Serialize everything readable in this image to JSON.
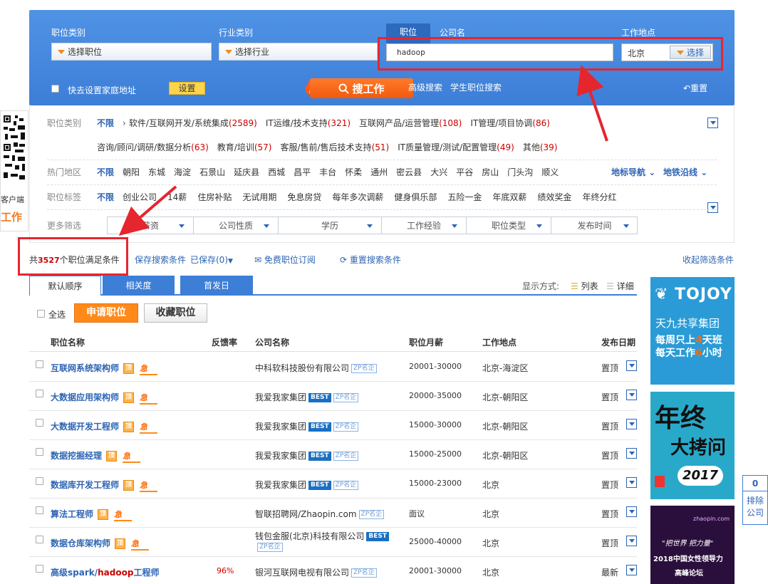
{
  "search": {
    "job_category_label": "职位类别",
    "job_category_value": "选择职位",
    "industry_label": "行业类别",
    "industry_value": "选择行业",
    "tab_position": "职位",
    "tab_company": "公司名",
    "keyword": "hadoop",
    "location_label": "工作地点",
    "location_value": "北京",
    "location_button": "选择",
    "home_address_label": "快去设置家庭地址",
    "set_button": "设置",
    "search_button": "搜工作",
    "advanced_search": "高级搜索",
    "student_search": "学生职位搜索",
    "reset": "重置"
  },
  "filters": {
    "category_title": "职位类别",
    "unlimited": "不限",
    "categories_row1": [
      {
        "name": "软件/互联网开发/系统集成",
        "count": "(2589)"
      },
      {
        "name": "IT运维/技术支持",
        "count": "(321)"
      },
      {
        "name": "互联网产品/运营管理",
        "count": "(108)"
      },
      {
        "name": "IT管理/项目协调",
        "count": "(86)"
      }
    ],
    "categories_row2": [
      {
        "name": "咨询/顾问/调研/数据分析",
        "count": "(63)"
      },
      {
        "name": "教育/培训",
        "count": "(57)"
      },
      {
        "name": "客服/售前/售后技术支持",
        "count": "(51)"
      },
      {
        "name": "IT质量管理/测试/配置管理",
        "count": "(49)"
      },
      {
        "name": "其他",
        "count": "(39)"
      }
    ],
    "area_title": "热门地区",
    "areas": [
      "朝阳",
      "东城",
      "海淀",
      "石景山",
      "延庆县",
      "西城",
      "昌平",
      "丰台",
      "怀柔",
      "通州",
      "密云县",
      "大兴",
      "平谷",
      "房山",
      "门头沟",
      "顺义"
    ],
    "landmark_nav": "地标导航",
    "subway_nav": "地铁沿线",
    "tag_title": "职位标签",
    "tags": [
      "创业公司",
      "14薪",
      "住房补贴",
      "无试用期",
      "免息房贷",
      "每年多次调薪",
      "健身俱乐部",
      "五险一金",
      "年底双薪",
      "绩效奖金",
      "年终分红"
    ],
    "more_title": "更多筛选",
    "more": [
      "薪资",
      "公司性质",
      "学历",
      "工作经验",
      "职位类型",
      "发布时间"
    ]
  },
  "results": {
    "prefix": "共",
    "count": "3527",
    "suffix": "个职位满足条件",
    "save_search": "保存搜索条件",
    "saved": "已保存(0)",
    "subscribe": "免费职位订阅",
    "reset_conditions": "重置搜索条件",
    "collapse": "收起筛选条件"
  },
  "sort": {
    "tabs": [
      "默认顺序",
      "相关度",
      "首发日"
    ],
    "display_label": "显示方式:",
    "list": "列表",
    "detail": "详细"
  },
  "actions": {
    "select_all": "全选",
    "apply": "申请职位",
    "favorite": "收藏职位"
  },
  "table": {
    "headers": [
      "职位名称",
      "反馈率",
      "公司名称",
      "职位月薪",
      "工作地点",
      "发布日期"
    ],
    "rows": [
      {
        "title": "互联网系统架构师",
        "ding": "顶",
        "ji": "急",
        "feedback": "",
        "company": "中科软科技股份有限公司",
        "best": false,
        "zp": "ZP名企",
        "salary": "20001-30000",
        "location": "北京-海淀区",
        "date": "置顶"
      },
      {
        "title": "大数据应用架构师",
        "ding": "顶",
        "ji": "急",
        "feedback": "",
        "company": "我爱我家集团",
        "best": true,
        "zp": "ZP名企",
        "salary": "20000-35000",
        "location": "北京-朝阳区",
        "date": "置顶"
      },
      {
        "title": "大数据开发工程师",
        "ding": "顶",
        "ji": "急",
        "feedback": "",
        "company": "我爱我家集团",
        "best": true,
        "zp": "ZP名企",
        "salary": "15000-30000",
        "location": "北京-朝阳区",
        "date": "置顶"
      },
      {
        "title": "数据挖掘经理",
        "ding": "顶",
        "ji": "急",
        "feedback": "",
        "company": "我爱我家集团",
        "best": true,
        "zp": "ZP名企",
        "salary": "15000-25000",
        "location": "北京-朝阳区",
        "date": "置顶"
      },
      {
        "title": "数据库开发工程师",
        "ding": "顶",
        "ji": "急",
        "feedback": "",
        "company": "我爱我家集团",
        "best": true,
        "zp": "ZP名企",
        "salary": "15000-23000",
        "location": "北京",
        "date": "置顶"
      },
      {
        "title": "算法工程师",
        "ding": "顶",
        "ji": "急",
        "feedback": "",
        "company": "智联招聘网/Zhaopin.com",
        "best": false,
        "zp": "ZP名企",
        "salary": "面议",
        "location": "北京",
        "date": "置顶"
      },
      {
        "title": "数据仓库架构师",
        "ding": "顶",
        "ji": "急",
        "feedback": "",
        "company": "钱包金服(北京)科技有限公司",
        "best": true,
        "zp": "ZP名企",
        "salary": "25000-40000",
        "location": "北京",
        "date": "置顶"
      },
      {
        "title_pre": "高级spark/",
        "title_hl": "hadoop",
        "title_post": "工程师",
        "feedback": "96%",
        "company": "银河互联网电视有限公司",
        "best": false,
        "zp": "ZP名企",
        "salary": "20001-30000",
        "location": "北京",
        "date": "最新"
      }
    ]
  },
  "ads": {
    "tojoy_brand": "TOJOY",
    "tojoy_line1": "天九共享集团",
    "tojoy_line2a": "每周只上",
    "tojoy_line2b": "4",
    "tojoy_line2c": "天班",
    "tojoy_line3a": "每天工作",
    "tojoy_line3b": "6",
    "tojoy_line3c": "小时",
    "yearend_line1": "年终",
    "yearend_line2": "大拷问",
    "yearend_year": "2017",
    "women_line1": "\"把世界 把力量\"",
    "women_line2": "2018中国女性领导力",
    "women_line3": "高峰论坛",
    "women_logo": "zhaopin.com"
  },
  "side": {
    "client": "客户端",
    "job": "工作",
    "count": "0",
    "text1": "排除",
    "text2": "公司"
  }
}
